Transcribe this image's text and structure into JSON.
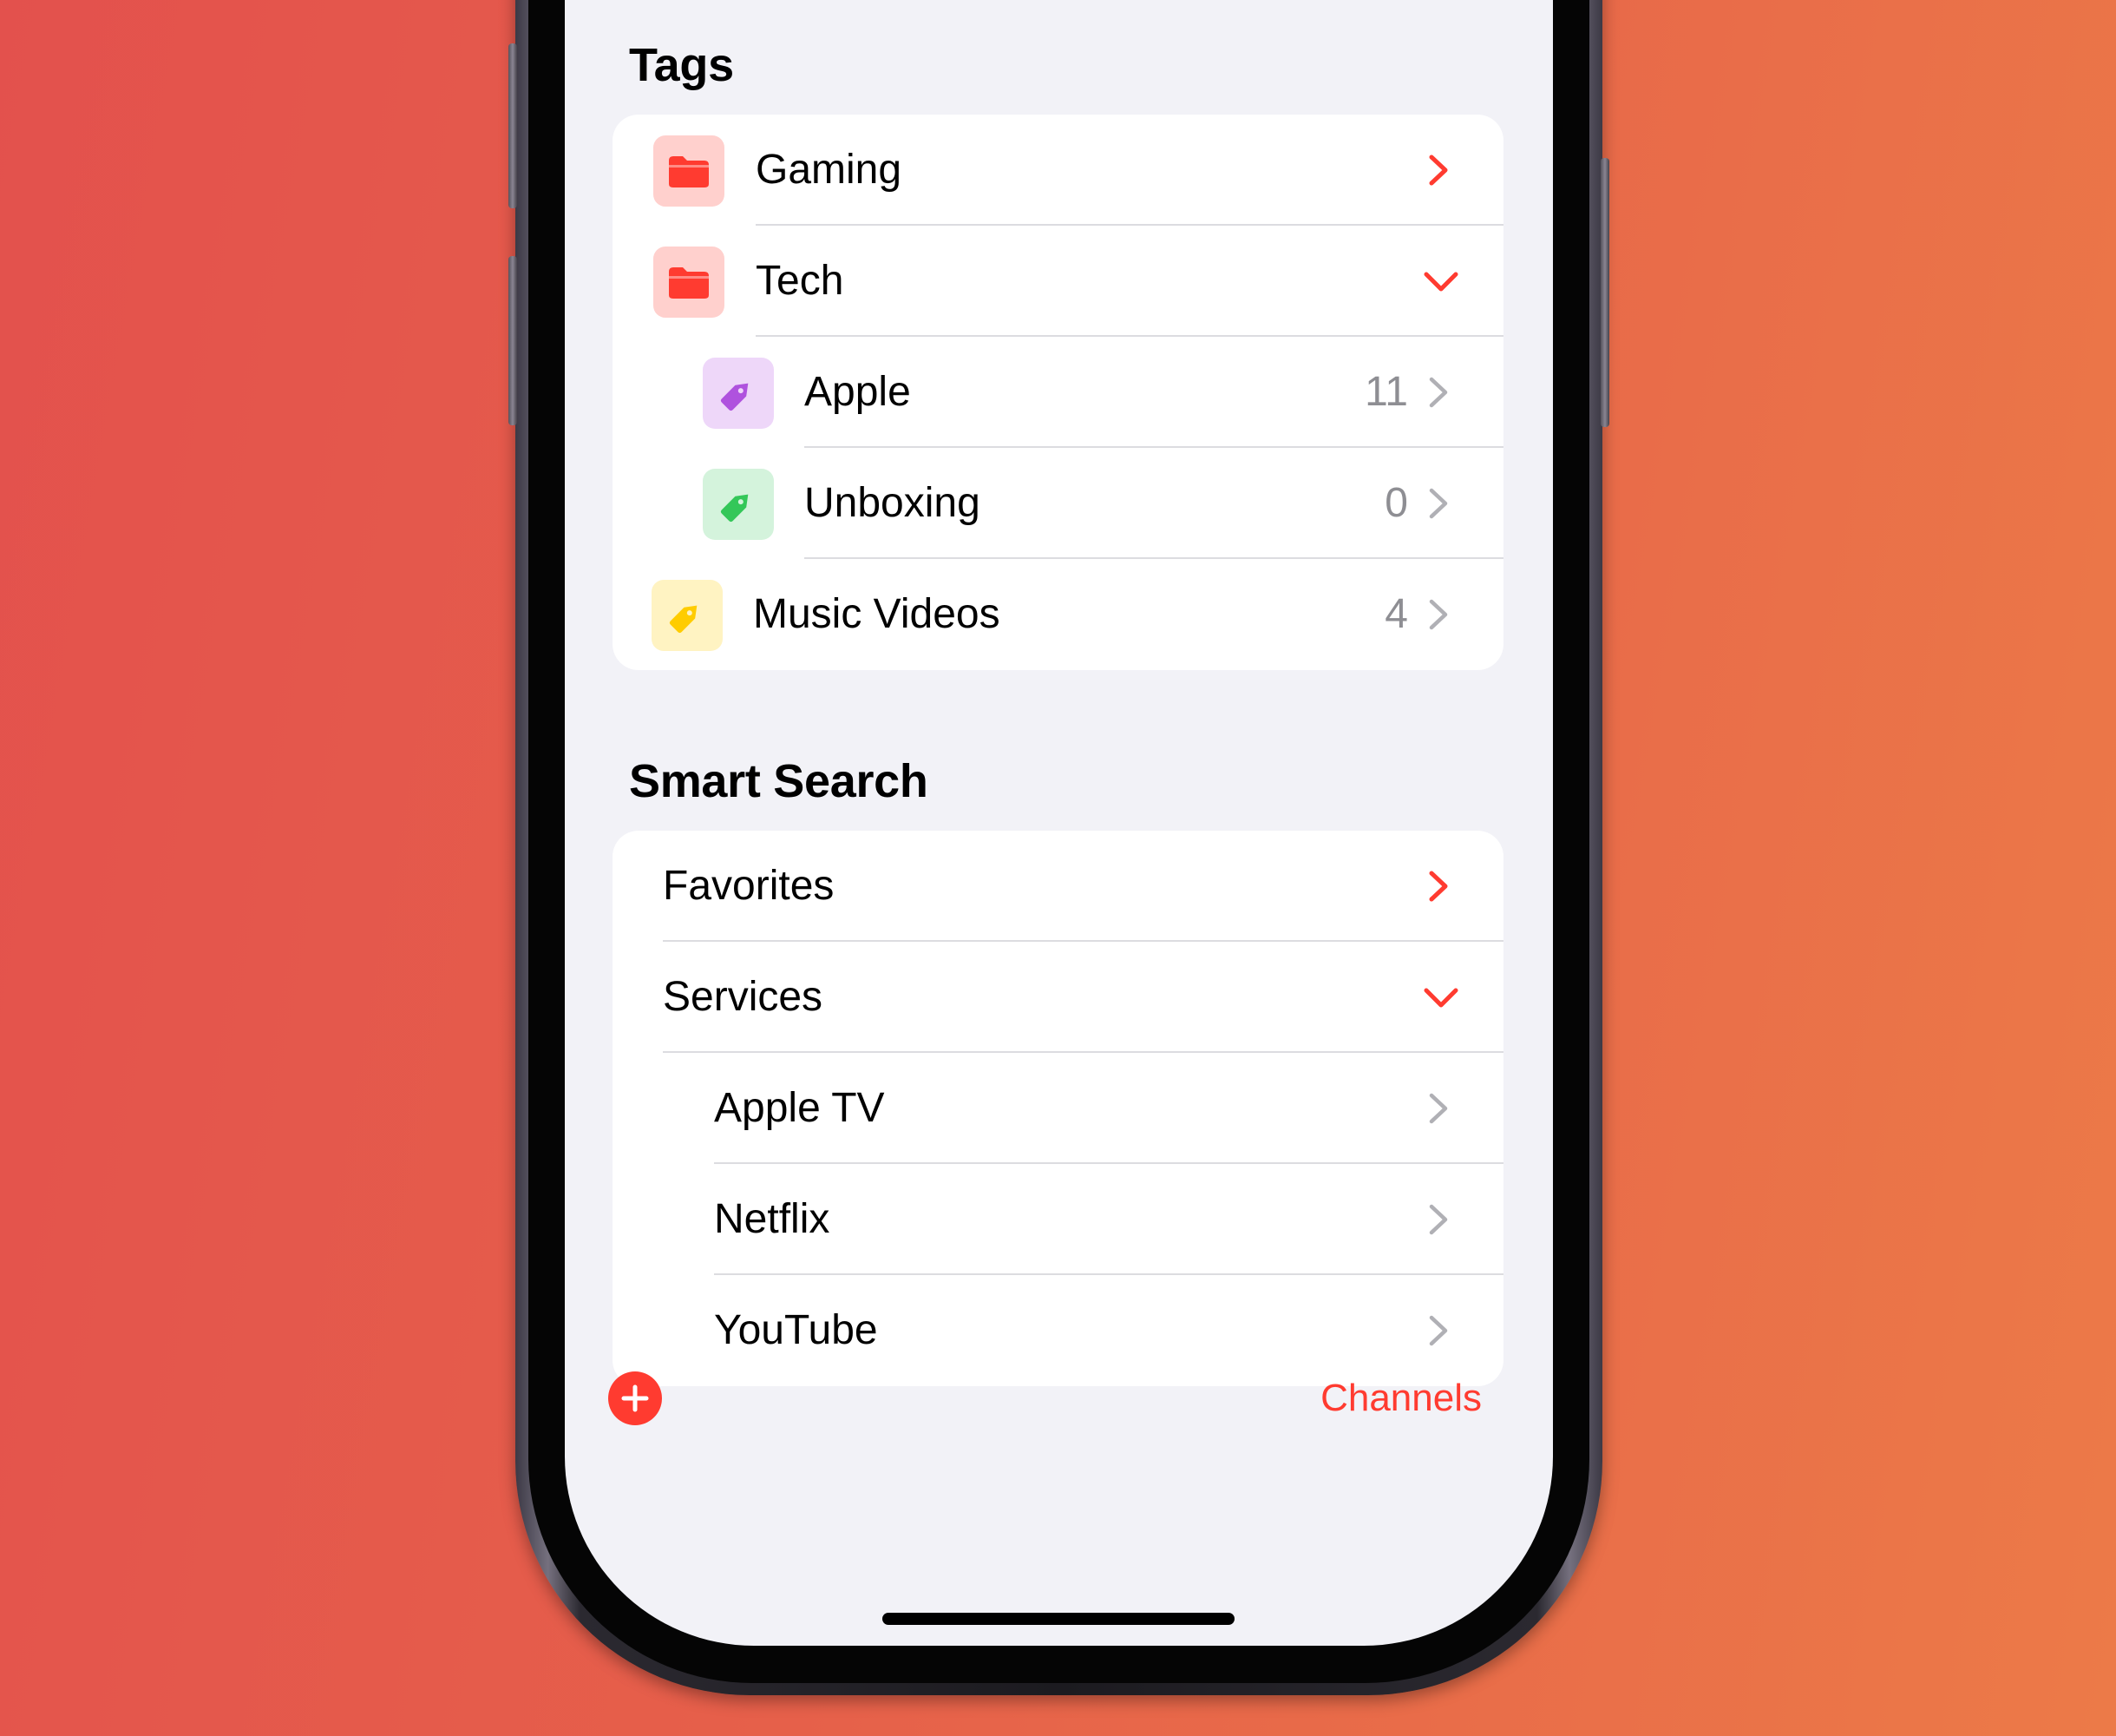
{
  "tags": {
    "title": "Tags",
    "items": [
      {
        "label": "Gaming",
        "icon": "folder-icon",
        "icon_color": "#ff3b30",
        "icon_bg": "#ffd0cd",
        "accessory": "chevron-right",
        "accent": "#ff3b30"
      },
      {
        "label": "Tech",
        "icon": "folder-icon",
        "icon_color": "#ff3b30",
        "icon_bg": "#ffd0cd",
        "accessory": "chevron-down",
        "accent": "#ff3b30"
      },
      {
        "label": "Apple",
        "count": "11",
        "icon": "tag-icon",
        "icon_color": "#af52de",
        "icon_bg": "#eed7f9"
      },
      {
        "label": "Unboxing",
        "count": "0",
        "icon": "tag-icon",
        "icon_color": "#34c759",
        "icon_bg": "#d4f3dc"
      },
      {
        "label": "Music Videos",
        "count": "4",
        "icon": "tag-icon",
        "icon_color": "#ffcc00",
        "icon_bg": "#fff3c2"
      }
    ]
  },
  "smart_search": {
    "title": "Smart Search",
    "items": [
      {
        "label": "Favorites",
        "accessory": "chevron-right",
        "accent": "#ff3b30"
      },
      {
        "label": "Services",
        "accessory": "chevron-down",
        "accent": "#ff3b30"
      },
      {
        "label": "Apple TV",
        "accessory": "chevron-right"
      },
      {
        "label": "Netflix",
        "accessory": "chevron-right"
      },
      {
        "label": "YouTube",
        "accessory": "chevron-right"
      }
    ]
  },
  "toolbar": {
    "add_icon": "plus-circle-icon",
    "channels_label": "Channels",
    "accent": "#ff3b30"
  }
}
